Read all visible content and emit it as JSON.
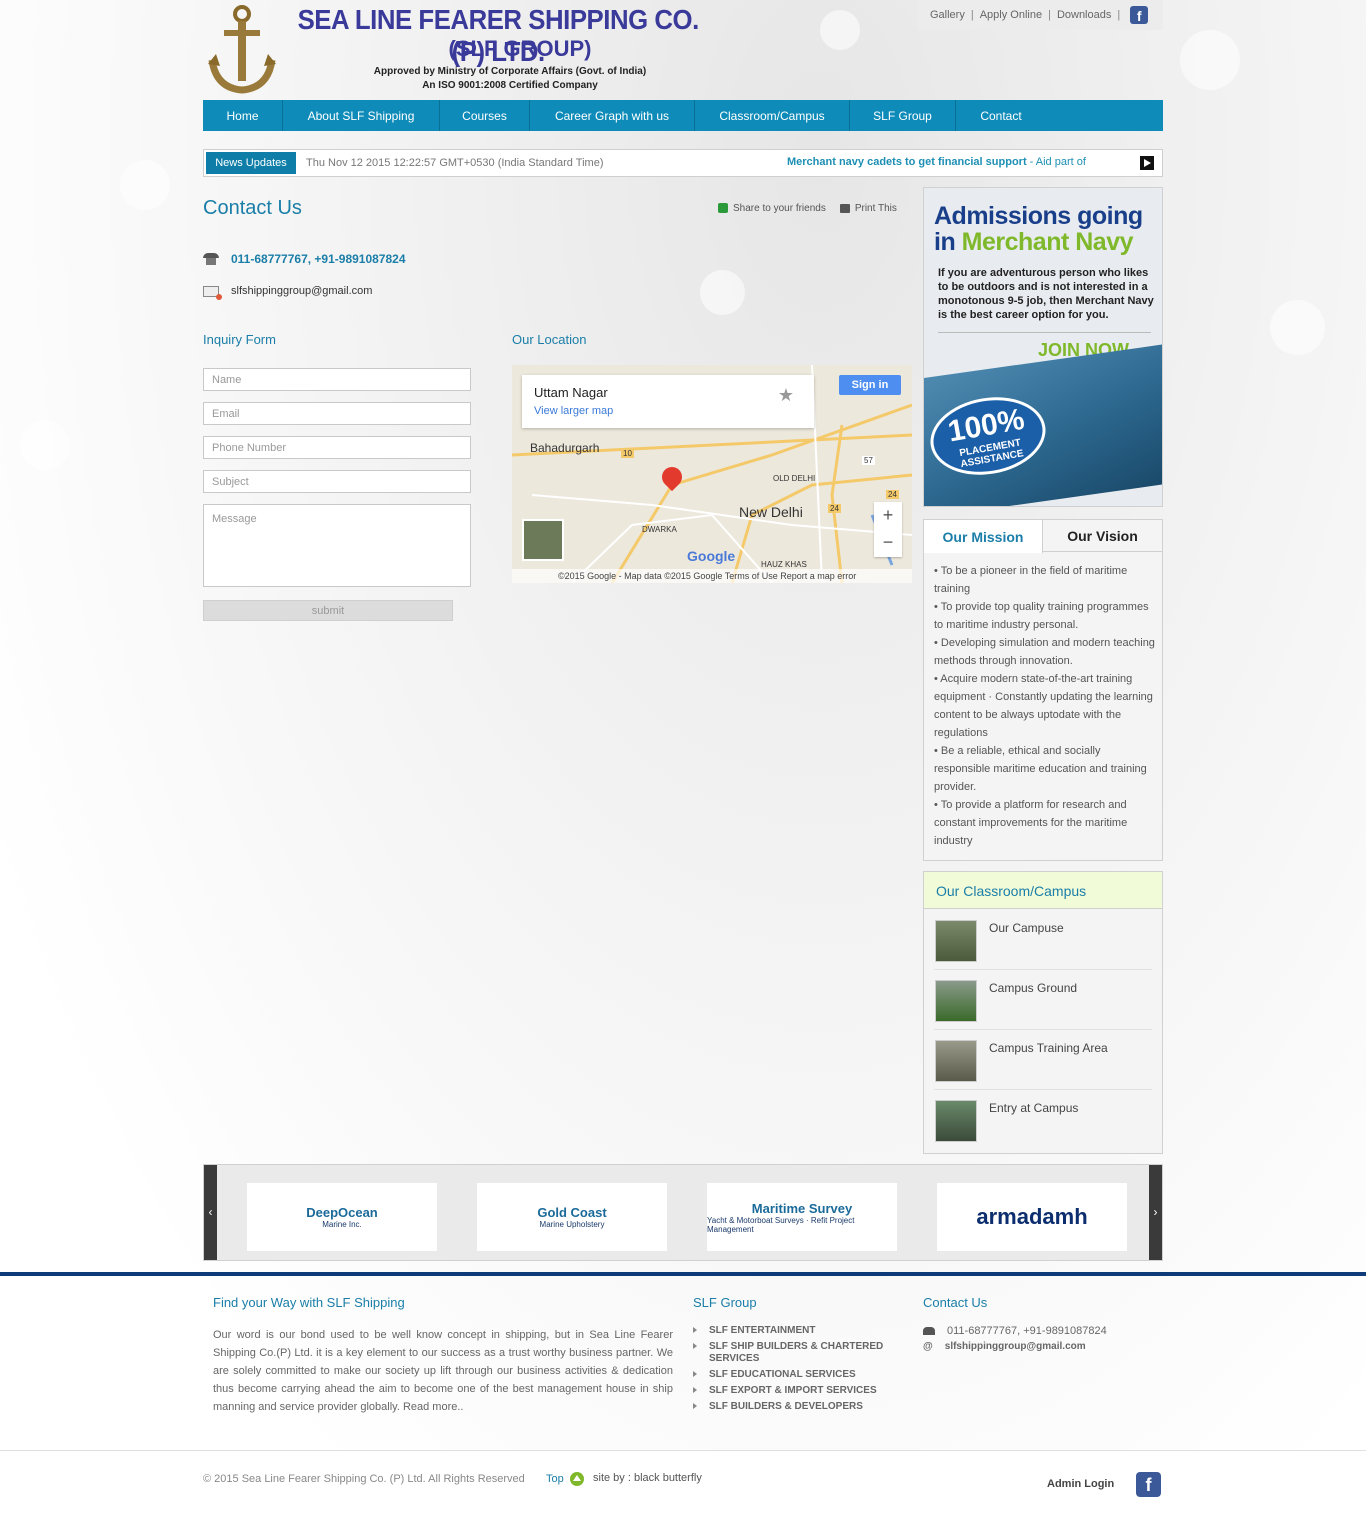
{
  "header": {
    "company": "SEA LINE FEARER SHIPPING CO. (P) LTD.",
    "group": "(SLF GROUP)",
    "approved": "Approved by Ministry of Corporate Affairs (Govt. of India)",
    "iso": "An ISO 9001:2008 Certified Company",
    "toplinks": [
      "Gallery",
      "Apply Online",
      "Downloads"
    ]
  },
  "nav": [
    "Home",
    "About SLF Shipping",
    "Courses",
    "Career Graph with us",
    "Classroom/Campus",
    "SLF Group",
    "Contact"
  ],
  "news": {
    "tag": "News Updates",
    "date": "Thu Nov 12 2015 12:22:57 GMT+0530 (India Standard Time)",
    "headline": "Merchant navy cadets to get financial support",
    "sub": " - Aid part of"
  },
  "contact": {
    "title": "Contact Us",
    "share": "Share to your friends",
    "print": "Print This",
    "phone": "011-68777767, +91-9891087824",
    "email": "slfshippinggroup@gmail.com"
  },
  "form": {
    "title": "Inquiry Form",
    "name_ph": "Name",
    "email_ph": "Email",
    "phone_ph": "Phone Number",
    "subject_ph": "Subject",
    "message_ph": "Message",
    "submit": "submit"
  },
  "location": {
    "title": "Our Location",
    "place": "Uttam Nagar",
    "larger": "View larger map",
    "signin": "Sign in",
    "labels": [
      "Bahadurgarh",
      "New Delhi",
      "OLD DELHI",
      "DWARKA",
      "HAUZ KHAS"
    ],
    "road_numbers": [
      "10",
      "57",
      "24",
      "24"
    ],
    "google": "Google",
    "footer": "©2015 Google - Map data ©2015 Google    Terms of Use    Report a map error"
  },
  "promo": {
    "line1": "Admissions going",
    "line2a": "in ",
    "line2b": "Merchant Navy",
    "text": "If you are adventurous person who likes to be outdoors and is not interested in a monotonous 9-5 job, then Merchant Navy is the best career option for you.",
    "join": "JOIN NOW",
    "badge_pct": "100%",
    "badge_text": "PLACEMENT ASSISTANCE"
  },
  "mission": {
    "tab_active": "Our Mission",
    "tab_other": "Our Vision",
    "items": [
      "• To be a pioneer in the field of maritime training",
      "• To provide top quality training programmes to maritime industry personal.",
      "• Developing simulation and modern teaching methods through innovation.",
      "• Acquire modern state-of-the-art training equipment · Constantly updating the learning content to be always uptodate with the regulations",
      "• Be a reliable, ethical and socially responsible maritime education and training provider.",
      "• To provide a platform for research and constant improvements for the maritime industry"
    ]
  },
  "campus": {
    "title": "Our Classroom/Campus",
    "items": [
      "Our Campuse",
      "Campus Ground",
      "Campus Training Area",
      "Entry at Campus"
    ]
  },
  "partners": [
    {
      "name": "DeepOcean",
      "sub": "Marine Inc."
    },
    {
      "name": "Gold Coast",
      "sub": "Marine Upholstery"
    },
    {
      "name": "Maritime Survey",
      "sub": "Yacht & Motorboat Surveys · Refit Project Management"
    },
    {
      "name": "armadamh",
      "sub": ""
    }
  ],
  "footer": {
    "about_title": "Find your Way with SLF Shipping",
    "about_text": "Our word is our bond used to be well know concept in shipping, but in Sea Line Fearer Shipping Co.(P) Ltd. it is a key element to our success as a trust worthy business partner. We are solely committed to make our society up lift through our business activities & dedication thus become carrying ahead the aim to become one of the best management house in ship manning and service provider globally. Read more..",
    "group_title": "SLF Group",
    "group_links": [
      "SLF ENTERTAINMENT",
      "SLF SHIP BUILDERS & CHARTERED SERVICES",
      "SLF EDUCATIONAL SERVICES",
      "SLF EXPORT & IMPORT SERVICES",
      "SLF BUILDERS & DEVELOPERS"
    ],
    "contact_title": "Contact Us",
    "phone": "011-68777767, +91-9891087824",
    "email": "slfshippinggroup@gmail.com",
    "copyright": "© 2015 Sea Line Fearer Shipping Co. (P) Ltd. All Rights Reserved",
    "top": "Top",
    "siteby": "site by : black butterfly",
    "admin": "Admin Login"
  }
}
